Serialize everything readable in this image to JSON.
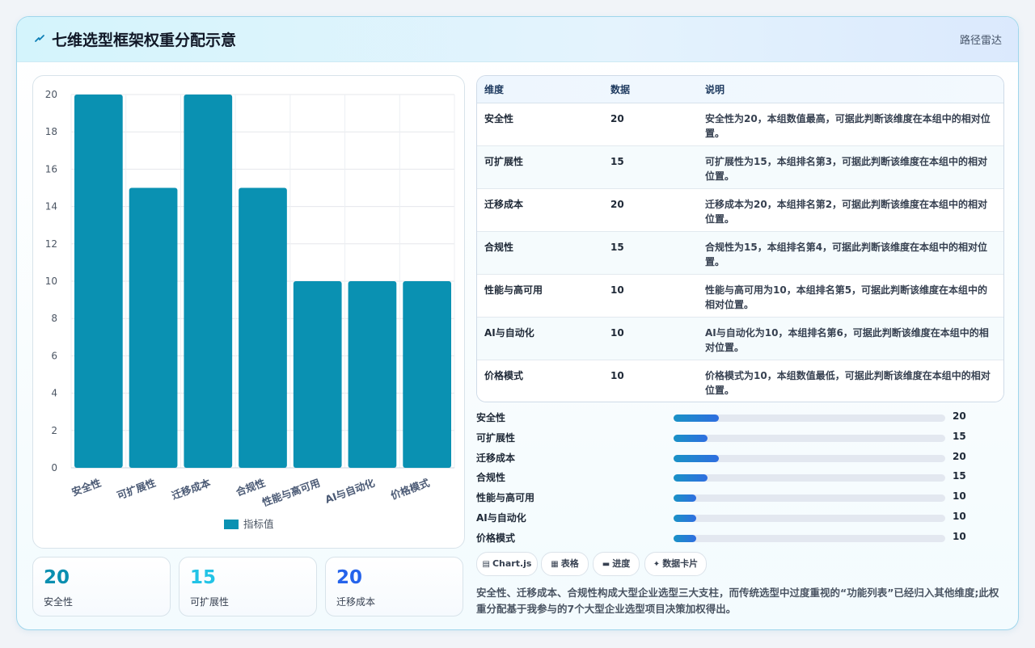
{
  "header": {
    "icon": "lightning-icon",
    "title": "七维选型框架权重分配示意",
    "tag": "路径雷达"
  },
  "chart_data": {
    "type": "bar",
    "categories": [
      "安全性",
      "可扩展性",
      "迁移成本",
      "合规性",
      "性能与高可用",
      "AI与自动化",
      "价格模式"
    ],
    "series": [
      {
        "name": "指标值",
        "values": [
          20,
          15,
          20,
          15,
          10,
          10,
          10
        ]
      }
    ],
    "ylim": [
      0,
      20
    ],
    "yticks": [
      0,
      2,
      4,
      6,
      8,
      10,
      12,
      14,
      16,
      18,
      20
    ],
    "grid": true,
    "legend": "bottom",
    "color": "#0a91b2"
  },
  "stats": [
    {
      "value": "20",
      "label": "安全性",
      "color": "#0a8fb0"
    },
    {
      "value": "15",
      "label": "可扩展性",
      "color": "#22c3e6"
    },
    {
      "value": "20",
      "label": "迁移成本",
      "color": "#2563eb"
    }
  ],
  "table": {
    "headers": [
      "维度",
      "数据",
      "说明"
    ],
    "rows": [
      {
        "dim": "安全性",
        "val": "20",
        "desc": "安全性为20，本组数值最高，可据此判断该维度在本组中的相对位置。"
      },
      {
        "dim": "可扩展性",
        "val": "15",
        "desc": "可扩展性为15，本组排名第3，可据此判断该维度在本组中的相对位置。"
      },
      {
        "dim": "迁移成本",
        "val": "20",
        "desc": "迁移成本为20，本组排名第2，可据此判断该维度在本组中的相对位置。"
      },
      {
        "dim": "合规性",
        "val": "15",
        "desc": "合规性为15，本组排名第4，可据此判断该维度在本组中的相对位置。"
      },
      {
        "dim": "性能与高可用",
        "val": "10",
        "desc": "性能与高可用为10，本组排名第5，可据此判断该维度在本组中的相对位置。"
      },
      {
        "dim": "AI与自动化",
        "val": "10",
        "desc": "AI与自动化为10，本组排名第6，可据此判断该维度在本组中的相对位置。"
      },
      {
        "dim": "价格模式",
        "val": "10",
        "desc": "价格模式为10，本组数值最低，可据此判断该维度在本组中的相对位置。"
      }
    ]
  },
  "progress": [
    {
      "label": "安全性",
      "value": "20",
      "fraction": 0.167
    },
    {
      "label": "可扩展性",
      "value": "15",
      "fraction": 0.125
    },
    {
      "label": "迁移成本",
      "value": "20",
      "fraction": 0.167
    },
    {
      "label": "合规性",
      "value": "15",
      "fraction": 0.125
    },
    {
      "label": "性能与高可用",
      "value": "10",
      "fraction": 0.083
    },
    {
      "label": "AI与自动化",
      "value": "10",
      "fraction": 0.083
    },
    {
      "label": "价格模式",
      "value": "10",
      "fraction": 0.083
    }
  ],
  "buttons": [
    {
      "icon": "chart-icon",
      "glyph": "▤",
      "label": "Chart.js"
    },
    {
      "icon": "table-icon",
      "glyph": "▦",
      "label": "表格"
    },
    {
      "icon": "progress-icon",
      "glyph": "▬",
      "label": "进度"
    },
    {
      "icon": "card-icon",
      "glyph": "✦",
      "label": "数据卡片"
    }
  ],
  "note": "安全性、迁移成本、合规性构成大型企业选型三大支柱，而传统选型中过度重视的“功能列表”已经归入其他维度;此权重分配基于我参与的7个大型企业选型项目决策加权得出。"
}
